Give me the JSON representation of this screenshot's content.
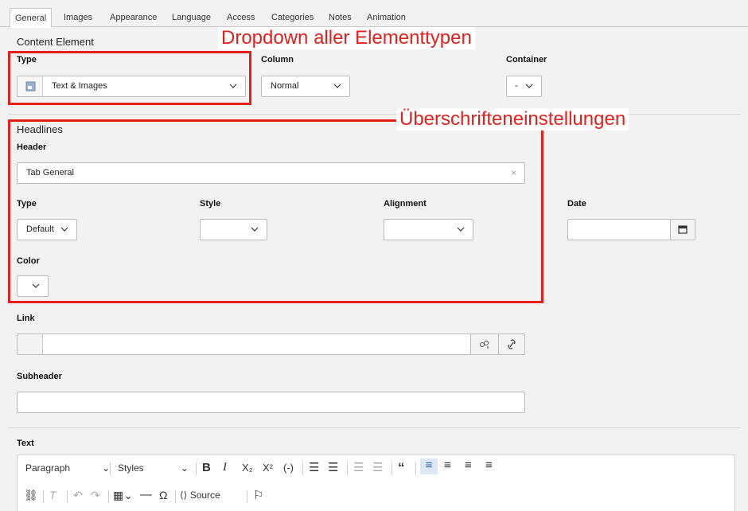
{
  "tabs": [
    "General",
    "Images",
    "Appearance",
    "Language",
    "Access",
    "Categories",
    "Notes",
    "Animation"
  ],
  "content_element": {
    "section_title": "Content Element",
    "type_label": "Type",
    "type_value": "Text & Images",
    "column_label": "Column",
    "column_value": "Normal",
    "container_label": "Container",
    "container_value": "-"
  },
  "headlines": {
    "section_title": "Headlines",
    "header_label": "Header",
    "header_value": "Tab General",
    "type_label": "Type",
    "type_value": "Default",
    "style_label": "Style",
    "style_value": "",
    "alignment_label": "Alignment",
    "alignment_value": "",
    "date_label": "Date",
    "date_value": "",
    "color_label": "Color",
    "color_value": ""
  },
  "link": {
    "label": "Link",
    "value": ""
  },
  "subheader": {
    "label": "Subheader",
    "value": ""
  },
  "text": {
    "label": "Text",
    "format_value": "Paragraph",
    "styles_value": "Styles",
    "source_label": "Source"
  },
  "annotations": {
    "dropdown": "Dropdown aller Elementtypen",
    "headings": "Überschrifteneinstellungen",
    "color": "#e3201b"
  },
  "icons": {
    "calendar": "calendar-icon",
    "clear": "clear-icon",
    "link_browser": "link-browser-icon",
    "link": "link-icon"
  }
}
